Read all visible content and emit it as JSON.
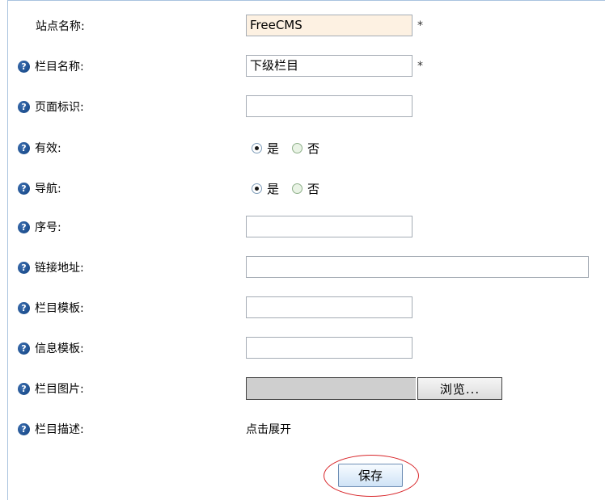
{
  "form": {
    "site_name": {
      "label": "站点名称:",
      "value": "FreeCMS",
      "required_mark": "*"
    },
    "column_name": {
      "label": "栏目名称:",
      "value": "下级栏目",
      "required_mark": "*"
    },
    "page_id": {
      "label": "页面标识:",
      "value": ""
    },
    "valid": {
      "label": "有效:",
      "options": [
        "是",
        "否"
      ],
      "selected": "是"
    },
    "navigation": {
      "label": "导航:",
      "options": [
        "是",
        "否"
      ],
      "selected": "是"
    },
    "order": {
      "label": "序号:",
      "value": ""
    },
    "link_url": {
      "label": "链接地址:",
      "value": ""
    },
    "column_template": {
      "label": "栏目模板:",
      "value": ""
    },
    "info_template": {
      "label": "信息模板:",
      "value": ""
    },
    "column_image": {
      "label": "栏目图片:",
      "browse_label": "浏览..."
    },
    "column_desc": {
      "label": "栏目描述:",
      "expand_text": "点击展开"
    },
    "save_label": "保存"
  },
  "icons": {
    "help": "help-icon",
    "help_glyph": "?"
  },
  "colors": {
    "help_icon": "#1d4f8f",
    "readonly_bg": "#fdf1e2",
    "highlight_ring": "#d8262a",
    "frame_border": "#a9c3df"
  }
}
